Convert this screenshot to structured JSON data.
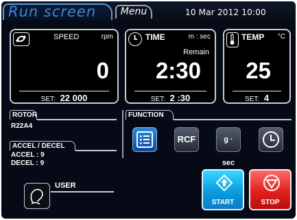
{
  "header": {
    "active_tab": "Run screen",
    "menu_tab": "Menu",
    "datetime": "10 Mar 2012 10:00"
  },
  "speed": {
    "icon": "rotation-icon",
    "label": "SPEED",
    "unit": "rpm",
    "value": "0",
    "set_label": "SET:",
    "set_value": "22 000"
  },
  "time": {
    "icon": "clock-icon",
    "label": "TIME",
    "unit": "m : sec",
    "sub": "Remain",
    "value": "2:30",
    "set_label": "SET:",
    "set_value": "2 :30"
  },
  "temp": {
    "icon": "thermometer-icon",
    "label": "TEMP",
    "unit": "°C",
    "value": "25",
    "set_label": "SET:",
    "set_value": "4"
  },
  "rotor": {
    "heading": "ROTOR",
    "value": "R22A4"
  },
  "accel_decel": {
    "heading": "ACCEL / DECEL",
    "accel": "ACCEL : 9",
    "decel": "DECEL : 9"
  },
  "function": {
    "heading": "FUNCTION",
    "buttons": [
      {
        "name": "list-icon",
        "label": ""
      },
      {
        "name": "rcf-button",
        "label": "RCF"
      },
      {
        "name": "g-sec-button",
        "label": "g · sec"
      },
      {
        "name": "timer-icon",
        "label": ""
      }
    ]
  },
  "user": {
    "label": "USER",
    "icon": "user-icon"
  },
  "controls": {
    "start_label": "START",
    "stop_label": "STOP"
  },
  "colors": {
    "background": "#060a16",
    "accent": "#3e87d6",
    "start": "#0a9ce0",
    "stop": "#e32020"
  }
}
